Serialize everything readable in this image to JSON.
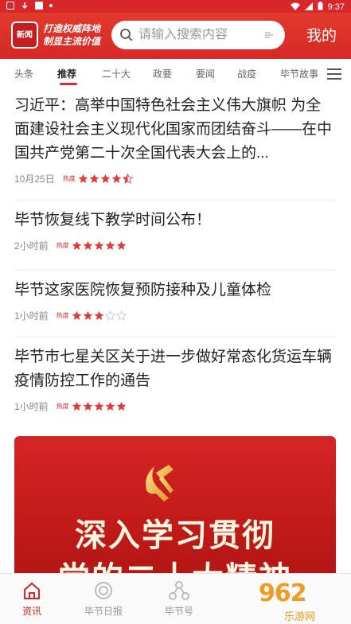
{
  "status_bar": {
    "time": "9:37"
  },
  "header": {
    "logo_badge": "新闻",
    "slogan_line1": "打造权威阵地",
    "slogan_line2": "制显主流价值",
    "search_placeholder": "请输入搜索内容",
    "mine_label": "我的"
  },
  "tabs": [
    {
      "label": "头条"
    },
    {
      "label": "推荐"
    },
    {
      "label": "二十大"
    },
    {
      "label": "政要"
    },
    {
      "label": "要闻"
    },
    {
      "label": "战疫"
    },
    {
      "label": "毕节故事"
    }
  ],
  "active_tab": "推荐",
  "news": [
    {
      "title": "习近平：高举中国特色社会主义伟大旗帜 为全面建设社会主义现代化国家而团结奋斗——在中国共产党第二十次全国代表大会上的...",
      "time": "10月25日",
      "heat_label": "热度",
      "rating": 4.5
    },
    {
      "title": "毕节恢复线下教学时间公布！",
      "time": "2小时前",
      "heat_label": "热度",
      "rating": 5
    },
    {
      "title": "毕节这家医院恢复预防接种及儿童体检",
      "time": "1小时前",
      "heat_label": "热度",
      "rating": 3
    },
    {
      "title": "毕节市七星关区关于进一步做好常态化货运车辆疫情防控工作的通告",
      "time": "1小时前",
      "heat_label": "热度",
      "rating": 5
    }
  ],
  "banner": {
    "line1": "深入学习贯彻",
    "line2": "党的二十大精神"
  },
  "bottom_nav": [
    {
      "label": "资讯",
      "icon": "home-icon"
    },
    {
      "label": "毕节日报",
      "icon": "newspaper-icon"
    },
    {
      "label": "毕节号",
      "icon": "network-icon"
    }
  ],
  "watermark": {
    "logo": "962",
    "sub": "乐游网"
  },
  "colors": {
    "brand_red": "#d8262a",
    "star_red": "#e33b3b",
    "star_empty": "#cccccc"
  }
}
